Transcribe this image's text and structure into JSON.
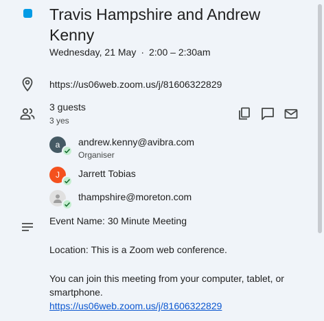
{
  "event": {
    "title": "Travis Hampshire and Andrew Kenny",
    "date": "Wednesday, 21 May",
    "separator": "·",
    "time": "2:00 – 2:30am",
    "color": "#039be5"
  },
  "location": {
    "url": "https://us06web.zoom.us/j/81606322829"
  },
  "guests": {
    "count_label": "3 guests",
    "yes_label": "3 yes",
    "list": [
      {
        "initial": "a",
        "name": "andrew.kenny@avibra.com",
        "role": "Organiser",
        "avatar_color": "#455a64"
      },
      {
        "initial": "J",
        "name": "Jarrett Tobias",
        "avatar_color": "#f4511e"
      },
      {
        "name": "thampshire@moreton.com",
        "avatar_color": "#e0e0e0"
      }
    ]
  },
  "actions": {
    "icons": [
      "copy-icon",
      "chat-icon",
      "mail-icon"
    ]
  },
  "description": {
    "line1": "Event Name: 30 Minute Meeting",
    "line2": "Location: This is a Zoom web conference.",
    "line3": "You can join this meeting from your computer, tablet, or smartphone.",
    "link": "https://us06web.zoom.us/j/81606322829"
  }
}
